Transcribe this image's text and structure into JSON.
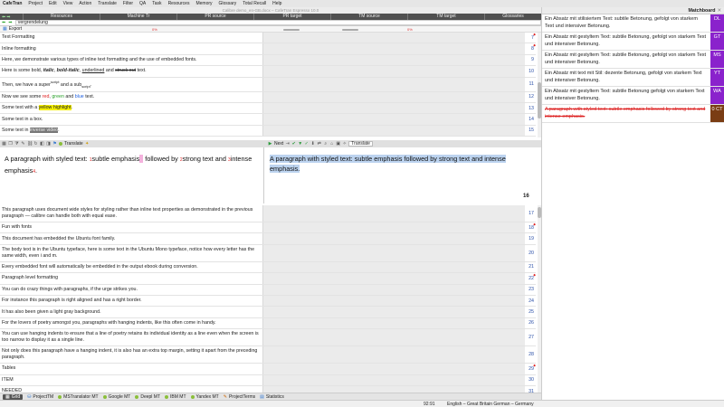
{
  "menubar": {
    "app": "CafeTran",
    "items": [
      "Project",
      "Edit",
      "View",
      "Action",
      "Translate",
      "Filter",
      "QA",
      "Task",
      "Resources",
      "Memory",
      "Glossary",
      "Total Recall",
      "Help"
    ]
  },
  "window": {
    "title": "Calibre demo_en-GB.docx – CafeTran Espresso 10.0"
  },
  "columns": [
    "Resources",
    "Machine Tr",
    "PR source",
    "PR target",
    "TM source",
    "TM target",
    "Glossaries"
  ],
  "source_field": {
    "value": "vergrendelung"
  },
  "export": {
    "label": "Export",
    "pct1": "0%",
    "pct2": "0%"
  },
  "grid_top": [
    {
      "src": "Text Formatting",
      "num": "7",
      "mark": "◆"
    },
    {
      "src": "Inline formatting",
      "num": "8",
      "mark": "◆"
    },
    {
      "src": "Here, we demonstrate various types of inline text formatting and the use of embedded fonts.",
      "num": "9"
    },
    {
      "src_parts": [
        "Here is some bold, ",
        "italic",
        ", ",
        "bold-italic",
        ", ",
        "underlined",
        " and ",
        "struck out",
        " text."
      ],
      "num": "10"
    },
    {
      "src_parts": [
        "Then, we have a super",
        "script",
        " and a sub",
        "script",
        "."
      ],
      "num": "11"
    },
    {
      "src_parts": [
        "Now we see some ",
        "red",
        ", ",
        "green",
        " and ",
        "blue",
        " text."
      ],
      "num": "12"
    },
    {
      "src_parts": [
        "Some text with a ",
        "yellow highlight",
        "."
      ],
      "num": "13"
    },
    {
      "src": "Some text in a box.",
      "num": "14"
    },
    {
      "src_parts": [
        "Some text in ",
        "inverse video",
        "."
      ],
      "num": "15"
    }
  ],
  "editor_toolbar_left": {
    "translate": "Translate"
  },
  "editor_toolbar_right": {
    "next": "Next",
    "translate_select": "Translate"
  },
  "source_pane": {
    "before": "A paragraph with styled text: ",
    "tag1": "1",
    "italic": "subtle emphasis",
    "after1": " followed by ",
    "tag2": "2",
    "bold": "strong text",
    "after2": " and ",
    "tag3": "3",
    "strong": "intense emphasis",
    "tag4": "4",
    "end": "."
  },
  "target_pane": {
    "text": "A paragraph with styled text: subtle emphasis  followed by strong text and intense emphasis."
  },
  "current_segment": "16",
  "grid_bottom": [
    {
      "src": "This paragraph uses document wide styles for styling rather than inline text properties as demonstrated in the previous paragraph — calibre can handle both with equal ease.",
      "num": "17",
      "tall": true
    },
    {
      "src": "Fun with fonts",
      "num": "18",
      "mark": "◆"
    },
    {
      "src": "This document has embedded the Ubuntu font family.",
      "num": "19"
    },
    {
      "src": "The body text is in the Ubuntu typeface, here is some text in the Ubuntu Mono typeface, notice how every letter has the same width, even i and m.",
      "num": "20",
      "tall": true
    },
    {
      "src": "Every embedded font will automatically be embedded in the output ebook during conversion.",
      "num": "21"
    },
    {
      "src": "Paragraph level formatting",
      "num": "22",
      "mark": "◆"
    },
    {
      "src": "You can do crazy things with paragraphs, if the urge strikes you.",
      "num": "23"
    },
    {
      "src": "For instance this paragraph is right aligned and has a right border.",
      "num": "24"
    },
    {
      "src": "It has also been given a light gray background.",
      "num": "25"
    },
    {
      "src": "For the lovers of poetry amongst you, paragraphs with hanging indents, like this often come in handy.",
      "num": "26"
    },
    {
      "src": "You can use hanging indents to ensure that a line of poetry retains its individual identity as a line even when the screen is  too narrow to display it as a single line.",
      "num": "27",
      "tall": true
    },
    {
      "src": "Not only does this paragraph have a hanging indent, it is also has an extra top margin, setting it apart from the preceding paragraph.",
      "num": "28",
      "tall": true
    },
    {
      "src": "Tables",
      "num": "29",
      "mark": "◆"
    },
    {
      "src": "ITEM",
      "num": "30"
    },
    {
      "src": "NEEDED",
      "num": "31"
    }
  ],
  "bottom_tabs": [
    "Grid",
    "ProjectTM",
    "MSTranslator MT",
    "Google MT",
    "Deepl MT",
    "IBM MT",
    "Yandex MT",
    "ProjectTerms",
    "Statistics"
  ],
  "status": {
    "zoom": "92:91",
    "lang": "English – Great Britain  German – Germany"
  },
  "matchboard": {
    "title": "Matchboard",
    "close": "✕",
    "items": [
      {
        "text": "Ein Absatz mit stilisiertem Text: subtile Betonung, gefolgt von starkem Text und intensiver Betonung.",
        "badge": "DL",
        "color": "#8a22cc"
      },
      {
        "text": "Ein Absatz mit gestyltem Text: subtile Betonung, gefolgt von starkem Text und intensiver Betonung.",
        "badge": "GT",
        "color": "#8a22cc"
      },
      {
        "text": "Ein Absatz mit gestyltem Text: subtile Betonung, gefolgt von starkem Text und intensiver Betonung.",
        "badge": "MS",
        "color": "#8a22cc"
      },
      {
        "text": "Ein Absatz mit text mit Stil: dezente Betonung, gefolgt von starkem Text und intensiver Betonung.",
        "badge": "YT",
        "color": "#8a22cc"
      },
      {
        "text": "Ein Absatz mit gestyltem Text: subtile Betonung gefolgt von starkem Text und intensiver Betonung.",
        "badge": "WA",
        "color": "#8a22cc"
      },
      {
        "text": "A paragraph with styled text: subtle emphasis  followed by strong text and intense emphasis.",
        "badge": "0  CT",
        "color": "#7a3d14",
        "deleted": true
      }
    ]
  }
}
